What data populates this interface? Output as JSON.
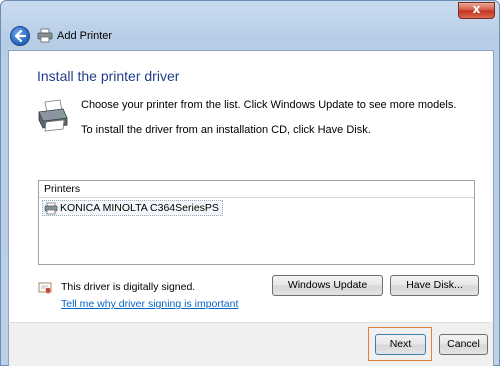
{
  "window": {
    "title": "Add Printer",
    "close_label": "x"
  },
  "main": {
    "heading": "Install the printer driver",
    "description_1": "Choose your printer from the list. Click Windows Update to see more models.",
    "description_2": "To install the driver from an installation CD, click Have Disk."
  },
  "printers_list": {
    "header": "Printers",
    "items": [
      {
        "label": "KONICA MINOLTA C364SeriesPS",
        "selected": true
      }
    ]
  },
  "signature": {
    "status_text": "This driver is digitally signed.",
    "link_text": "Tell me why driver signing is important"
  },
  "buttons": {
    "windows_update": "Windows Update",
    "have_disk": "Have Disk...",
    "next": "Next",
    "cancel": "Cancel"
  },
  "icons": {
    "back": "back-arrow-icon",
    "title": "printer-icon",
    "hero": "printer-icon",
    "row": "printer-icon",
    "signed": "certificate-icon"
  },
  "colors": {
    "heading": "#1e3f8a",
    "link": "#0a64c8",
    "highlight": "#e77d3a"
  }
}
